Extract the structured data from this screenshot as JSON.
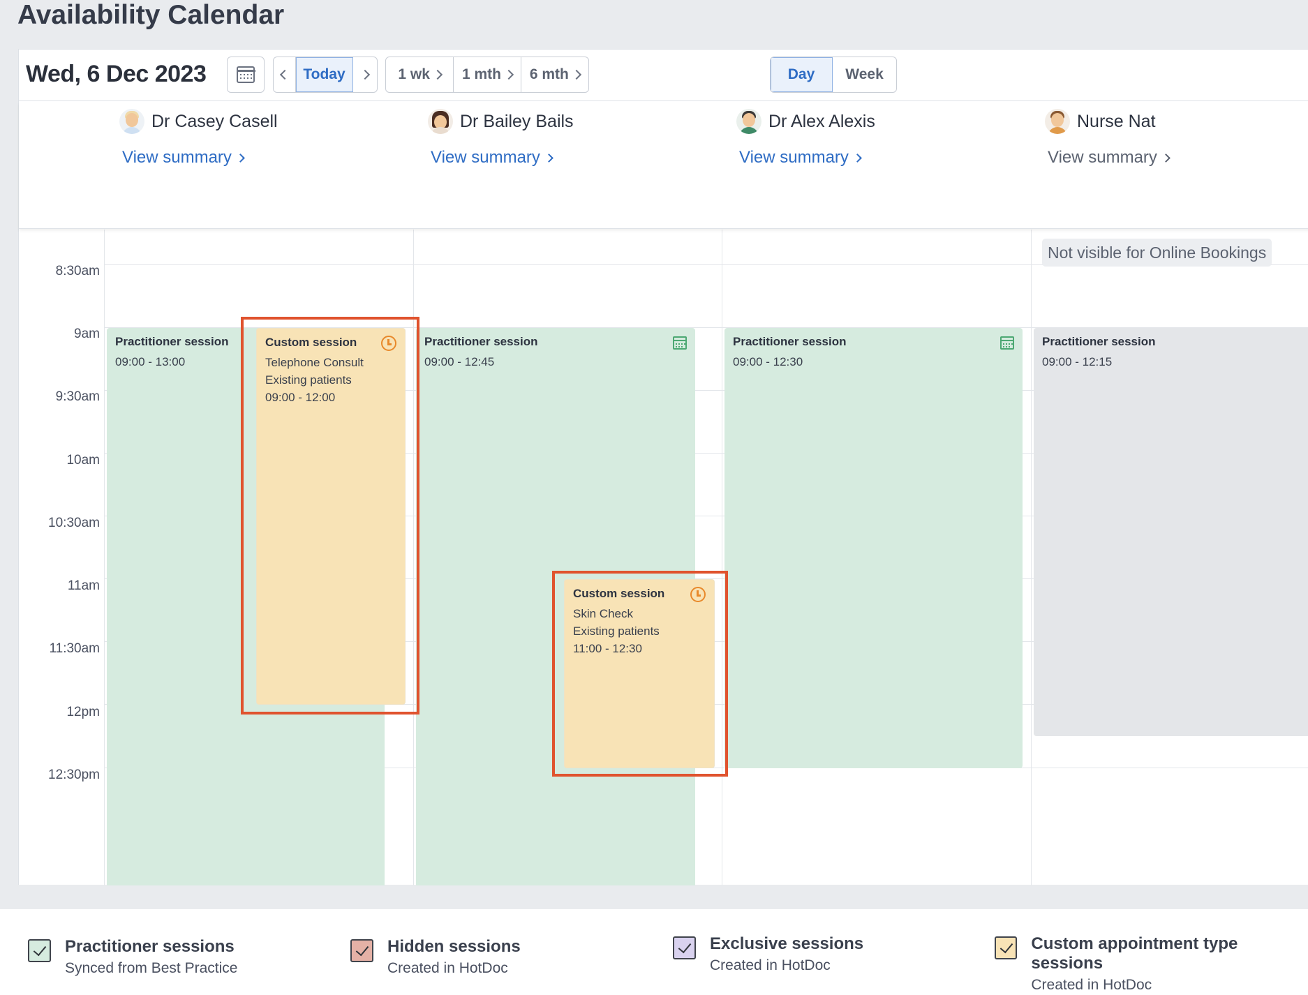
{
  "page": {
    "title": "Availability Calendar"
  },
  "toolbar": {
    "date": "Wed, 6 Dec 2023",
    "today_label": "Today",
    "range_1wk": "1 wk",
    "range_1mth": "1 mth",
    "range_6mth": "6 mth",
    "view_day": "Day",
    "view_week": "Week",
    "active_view": "Day"
  },
  "practitioners": [
    {
      "name": "Dr Casey Casell",
      "summary_label": "View summary"
    },
    {
      "name": "Dr Bailey Bails",
      "summary_label": "View summary"
    },
    {
      "name": "Dr Alex Alexis",
      "summary_label": "View summary"
    },
    {
      "name": "Nurse Nat",
      "summary_label": "View summary",
      "badge": "Not visible for Online Bookings"
    }
  ],
  "time_slots": [
    "8:30am",
    "9am",
    "9:30am",
    "10am",
    "10:30am",
    "11am",
    "11:30am",
    "12pm",
    "12:30pm"
  ],
  "sessions": {
    "casey_practitioner": {
      "title": "Practitioner session",
      "time": "09:00 - 13:00"
    },
    "casey_custom": {
      "title": "Custom session",
      "type": "Telephone Consult",
      "audience": "Existing patients",
      "time": "09:00 - 12:00"
    },
    "bailey_practitioner": {
      "title": "Practitioner session",
      "time": "09:00 - 12:45"
    },
    "bailey_custom": {
      "title": "Custom session",
      "type": "Skin Check",
      "audience": "Existing patients",
      "time": "11:00 - 12:30"
    },
    "alex_practitioner": {
      "title": "Practitioner session",
      "time": "09:00 - 12:30"
    },
    "nat_practitioner": {
      "title": "Practitioner session",
      "time": "09:00 - 12:15"
    }
  },
  "legend": [
    {
      "title": "Practitioner sessions",
      "subtitle": "Synced from Best Practice",
      "color": "#d6ebdf"
    },
    {
      "title": "Hidden sessions",
      "subtitle": "Created in HotDoc",
      "color": "#e4b1a6"
    },
    {
      "title": "Exclusive sessions",
      "subtitle": "Created in HotDoc",
      "color": "#d9d2ef"
    },
    {
      "title": "Custom appointment type sessions",
      "subtitle": "Created in HotDoc",
      "color": "#f8e3b6"
    }
  ],
  "colors": {
    "accent": "#2e6cc4",
    "highlight": "#e0532e",
    "green_session": "#d6ebdf",
    "custom_session": "#f8e3b6",
    "hidden_session": "#e4e6e9"
  }
}
